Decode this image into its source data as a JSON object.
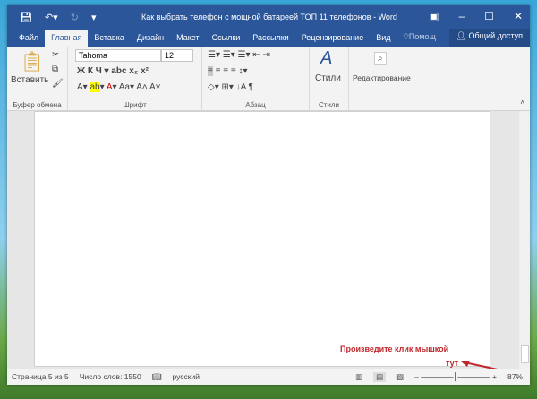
{
  "title": "Как выбрать телефон с мощной батареей ТОП 11 телефонов - Word",
  "tabs": [
    "Файл",
    "Главная",
    "Вставка",
    "Дизайн",
    "Макет",
    "Ссылки",
    "Рассылки",
    "Рецензирование",
    "Вид"
  ],
  "help": "Помощ",
  "share": "Общий доступ",
  "ribbon": {
    "paste": "Вставить",
    "font": "Tahoma",
    "size": "12",
    "styles": "Стили",
    "editing": "Редактирование",
    "groups": [
      "Буфер обмена",
      "Шрифт",
      "Абзац",
      "Стили"
    ]
  },
  "status": {
    "page": "Страница 5 из 5",
    "words": "Число слов: 1550",
    "lang": "русский",
    "zoom": "87%"
  },
  "annotation": {
    "line1": "Произведите клик мышкой",
    "line2": "тут",
    "color": "#c0282d"
  }
}
